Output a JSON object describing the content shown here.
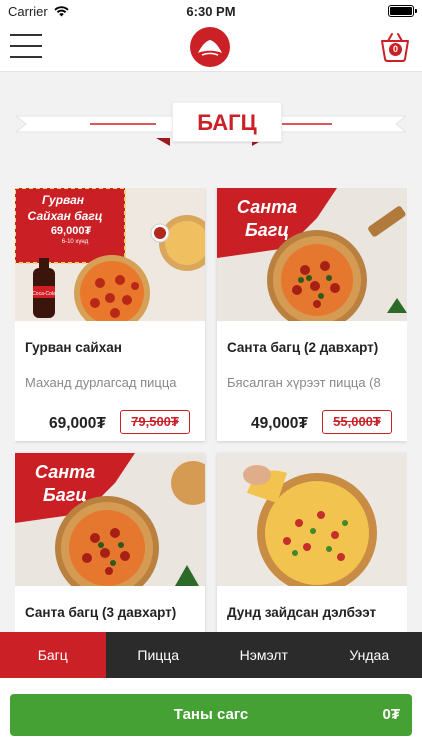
{
  "status": {
    "carrier": "Carrier",
    "time": "6:30 PM"
  },
  "header": {
    "cart_count": "0"
  },
  "section": {
    "title": "БАГЦ"
  },
  "products": [
    {
      "name": "Гурван сайхан",
      "description": "Маханд дурлагсад пицца",
      "price": "69,000₮",
      "old_price": "79,500₮",
      "image_text": {
        "line1": "Гурван",
        "line2": "Сайхан багц",
        "badge": "69,000₮",
        "badge_sub": "6-10 хүнд",
        "bottle": "Coca-Cola"
      }
    },
    {
      "name": "Санта багц (2 давхарт)",
      "description": "Бясалган хүрээт пицца (8",
      "price": "49,000₮",
      "old_price": "55,000₮",
      "image_text": {
        "line1": "Санта",
        "line2": "Багц"
      }
    },
    {
      "name": "Санта багц (3 давхарт)",
      "description": "",
      "price": "",
      "old_price": "",
      "image_text": {
        "line1": "Санта",
        "line2": "Багц"
      }
    },
    {
      "name": "Дунд зайдсан дэлбээт",
      "description": "",
      "price": "",
      "old_price": ""
    }
  ],
  "tabs": [
    {
      "label": "Багц",
      "active": true
    },
    {
      "label": "Пицца",
      "active": false
    },
    {
      "label": "Нэмэлт",
      "active": false
    },
    {
      "label": "Ундаа",
      "active": false
    }
  ],
  "checkout": {
    "label": "Таны сагс",
    "total": "0₮"
  },
  "colors": {
    "brand_red": "#cc2027",
    "checkout_green": "#46a135",
    "tab_bar": "#2b2b2b",
    "background": "#f2f2f2"
  }
}
